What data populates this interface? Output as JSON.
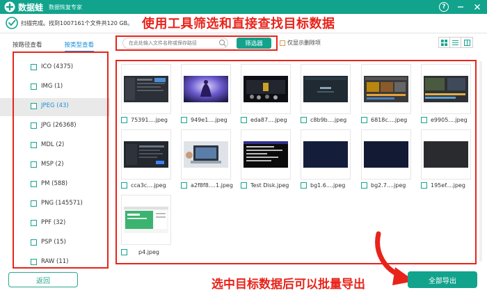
{
  "titlebar": {
    "app_name": "数据蛙",
    "app_sub": "数据恢复专家",
    "help": "?"
  },
  "status": {
    "text": "扫描完成。找到1007161个文件共120 GB。"
  },
  "annotations": {
    "top": "使用工具筛选和直接查找目标数据",
    "bottom": "选中目标数据后可以批量导出"
  },
  "view_tabs": {
    "by_path": "按路径查看",
    "by_type": "按类型查看"
  },
  "sidebar": {
    "items": [
      {
        "label": "ICO (4375)"
      },
      {
        "label": "IMG (1)"
      },
      {
        "label": "JPEG (43)",
        "selected": true
      },
      {
        "label": "JPG (26368)"
      },
      {
        "label": "MDL (2)"
      },
      {
        "label": "MSP (2)"
      },
      {
        "label": "PM (588)"
      },
      {
        "label": "PNG (145571)"
      },
      {
        "label": "PPF (32)"
      },
      {
        "label": "PSP (15)"
      },
      {
        "label": "RAW (11)"
      }
    ]
  },
  "toolbar": {
    "search_placeholder": "在此处输入文件名称或保存路径",
    "filter_label": "筛选器",
    "deleted_only_label": "仅显示删除项"
  },
  "files": [
    {
      "name": "75391....jpeg",
      "thumb": "dark-ui"
    },
    {
      "name": "949e1....jpeg",
      "thumb": "purple-art"
    },
    {
      "name": "eda87....jpeg",
      "thumb": "stage"
    },
    {
      "name": "c8b9b....jpeg",
      "thumb": "dark-teal"
    },
    {
      "name": "6818c....jpeg",
      "thumb": "editor"
    },
    {
      "name": "e9905....jpeg",
      "thumb": "editor2"
    },
    {
      "name": "cca3c....jpeg",
      "thumb": "dark-ui2"
    },
    {
      "name": "a2f8f8....1.jpeg",
      "thumb": "laptop"
    },
    {
      "name": "Test Disk.jpeg",
      "thumb": "terminal"
    },
    {
      "name": "bg1.6....jpeg",
      "thumb": "navy"
    },
    {
      "name": "bg2.7....jpeg",
      "thumb": "navy2"
    },
    {
      "name": "195ef....jpeg",
      "thumb": "dark-gray"
    },
    {
      "name": "p4.jpeg",
      "thumb": "green-web"
    }
  ],
  "buttons": {
    "back": "返回",
    "export_all": "全部导出"
  },
  "colors": {
    "brand": "#12a38d",
    "annotation": "#e8231a",
    "link": "#1a8fd8"
  }
}
